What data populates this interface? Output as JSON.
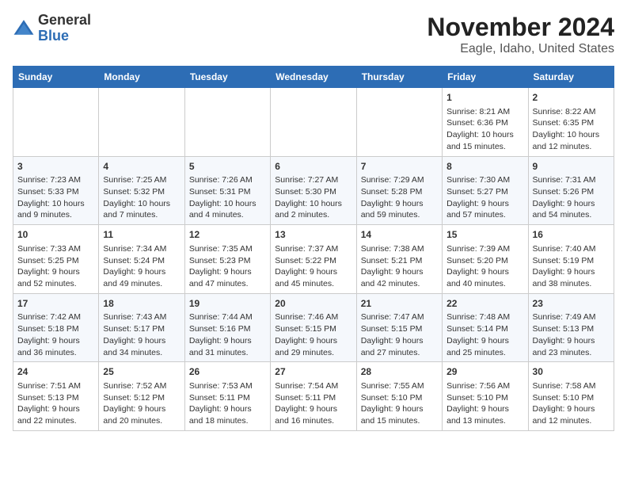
{
  "logo": {
    "general": "General",
    "blue": "Blue"
  },
  "title": "November 2024",
  "subtitle": "Eagle, Idaho, United States",
  "weekdays": [
    "Sunday",
    "Monday",
    "Tuesday",
    "Wednesday",
    "Thursday",
    "Friday",
    "Saturday"
  ],
  "weeks": [
    [
      {
        "day": "",
        "info": ""
      },
      {
        "day": "",
        "info": ""
      },
      {
        "day": "",
        "info": ""
      },
      {
        "day": "",
        "info": ""
      },
      {
        "day": "",
        "info": ""
      },
      {
        "day": "1",
        "info": "Sunrise: 8:21 AM\nSunset: 6:36 PM\nDaylight: 10 hours and 15 minutes."
      },
      {
        "day": "2",
        "info": "Sunrise: 8:22 AM\nSunset: 6:35 PM\nDaylight: 10 hours and 12 minutes."
      }
    ],
    [
      {
        "day": "3",
        "info": "Sunrise: 7:23 AM\nSunset: 5:33 PM\nDaylight: 10 hours and 9 minutes."
      },
      {
        "day": "4",
        "info": "Sunrise: 7:25 AM\nSunset: 5:32 PM\nDaylight: 10 hours and 7 minutes."
      },
      {
        "day": "5",
        "info": "Sunrise: 7:26 AM\nSunset: 5:31 PM\nDaylight: 10 hours and 4 minutes."
      },
      {
        "day": "6",
        "info": "Sunrise: 7:27 AM\nSunset: 5:30 PM\nDaylight: 10 hours and 2 minutes."
      },
      {
        "day": "7",
        "info": "Sunrise: 7:29 AM\nSunset: 5:28 PM\nDaylight: 9 hours and 59 minutes."
      },
      {
        "day": "8",
        "info": "Sunrise: 7:30 AM\nSunset: 5:27 PM\nDaylight: 9 hours and 57 minutes."
      },
      {
        "day": "9",
        "info": "Sunrise: 7:31 AM\nSunset: 5:26 PM\nDaylight: 9 hours and 54 minutes."
      }
    ],
    [
      {
        "day": "10",
        "info": "Sunrise: 7:33 AM\nSunset: 5:25 PM\nDaylight: 9 hours and 52 minutes."
      },
      {
        "day": "11",
        "info": "Sunrise: 7:34 AM\nSunset: 5:24 PM\nDaylight: 9 hours and 49 minutes."
      },
      {
        "day": "12",
        "info": "Sunrise: 7:35 AM\nSunset: 5:23 PM\nDaylight: 9 hours and 47 minutes."
      },
      {
        "day": "13",
        "info": "Sunrise: 7:37 AM\nSunset: 5:22 PM\nDaylight: 9 hours and 45 minutes."
      },
      {
        "day": "14",
        "info": "Sunrise: 7:38 AM\nSunset: 5:21 PM\nDaylight: 9 hours and 42 minutes."
      },
      {
        "day": "15",
        "info": "Sunrise: 7:39 AM\nSunset: 5:20 PM\nDaylight: 9 hours and 40 minutes."
      },
      {
        "day": "16",
        "info": "Sunrise: 7:40 AM\nSunset: 5:19 PM\nDaylight: 9 hours and 38 minutes."
      }
    ],
    [
      {
        "day": "17",
        "info": "Sunrise: 7:42 AM\nSunset: 5:18 PM\nDaylight: 9 hours and 36 minutes."
      },
      {
        "day": "18",
        "info": "Sunrise: 7:43 AM\nSunset: 5:17 PM\nDaylight: 9 hours and 34 minutes."
      },
      {
        "day": "19",
        "info": "Sunrise: 7:44 AM\nSunset: 5:16 PM\nDaylight: 9 hours and 31 minutes."
      },
      {
        "day": "20",
        "info": "Sunrise: 7:46 AM\nSunset: 5:15 PM\nDaylight: 9 hours and 29 minutes."
      },
      {
        "day": "21",
        "info": "Sunrise: 7:47 AM\nSunset: 5:15 PM\nDaylight: 9 hours and 27 minutes."
      },
      {
        "day": "22",
        "info": "Sunrise: 7:48 AM\nSunset: 5:14 PM\nDaylight: 9 hours and 25 minutes."
      },
      {
        "day": "23",
        "info": "Sunrise: 7:49 AM\nSunset: 5:13 PM\nDaylight: 9 hours and 23 minutes."
      }
    ],
    [
      {
        "day": "24",
        "info": "Sunrise: 7:51 AM\nSunset: 5:13 PM\nDaylight: 9 hours and 22 minutes."
      },
      {
        "day": "25",
        "info": "Sunrise: 7:52 AM\nSunset: 5:12 PM\nDaylight: 9 hours and 20 minutes."
      },
      {
        "day": "26",
        "info": "Sunrise: 7:53 AM\nSunset: 5:11 PM\nDaylight: 9 hours and 18 minutes."
      },
      {
        "day": "27",
        "info": "Sunrise: 7:54 AM\nSunset: 5:11 PM\nDaylight: 9 hours and 16 minutes."
      },
      {
        "day": "28",
        "info": "Sunrise: 7:55 AM\nSunset: 5:10 PM\nDaylight: 9 hours and 15 minutes."
      },
      {
        "day": "29",
        "info": "Sunrise: 7:56 AM\nSunset: 5:10 PM\nDaylight: 9 hours and 13 minutes."
      },
      {
        "day": "30",
        "info": "Sunrise: 7:58 AM\nSunset: 5:10 PM\nDaylight: 9 hours and 12 minutes."
      }
    ]
  ]
}
